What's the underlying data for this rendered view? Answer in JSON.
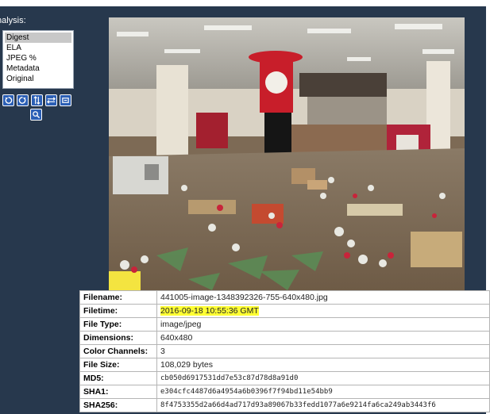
{
  "analysis": {
    "label": "nalysis:",
    "options": [
      "Digest",
      "ELA",
      "JPEG %",
      "Metadata",
      "Original"
    ],
    "selected": "Digest"
  },
  "toolbar": {
    "icons": [
      "rotate-left-icon",
      "rotate-right-icon",
      "flip-vertical-icon",
      "flip-horizontal-icon",
      "fit-icon"
    ],
    "zoom_icon": "magnifier-icon"
  },
  "info": {
    "rows": [
      {
        "key": "Filename:",
        "value": "441005-image-1348392326-755-640x480.jpg"
      },
      {
        "key": "Filetime:",
        "value": "2016-09-18 10:55:36 GMT",
        "highlight": true
      },
      {
        "key": "File Type:",
        "value": "image/jpeg"
      },
      {
        "key": "Dimensions:",
        "value": "640x480"
      },
      {
        "key": "Color Channels:",
        "value": "3"
      },
      {
        "key": "File Size:",
        "value": "108,029 bytes"
      },
      {
        "key": "MD5:",
        "value": "cb050d6917531dd7e53c87d78d8a91d0",
        "mono": true
      },
      {
        "key": "SHA1:",
        "value": "e304cfc4487d6a4954a6b0396f7f94bd11e54bb9",
        "mono": true
      },
      {
        "key": "SHA256:",
        "value": "8f4753355d2a66d4ad717d93a89067b33fedd1077a6e9214fa6ca249ab3443f6",
        "mono": true
      }
    ]
  },
  "colors": {
    "panel_bg": "#27384d",
    "button_bg": "#2b5fb5",
    "highlight": "#ffff33"
  }
}
